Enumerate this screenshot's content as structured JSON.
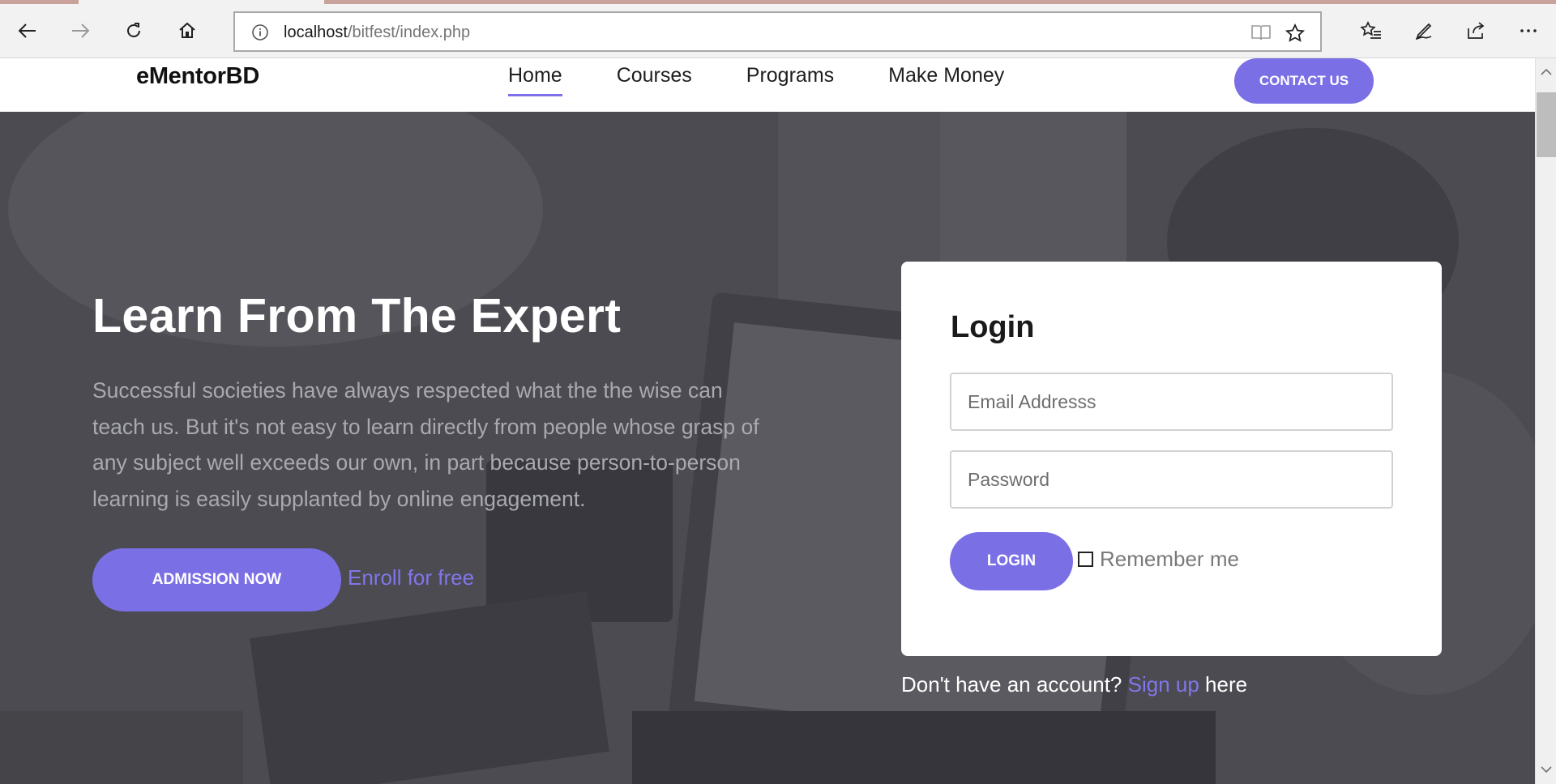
{
  "browser": {
    "url_host": "localhost",
    "url_path": "/bitfest/index.php",
    "icons": [
      "back-icon",
      "forward-icon",
      "refresh-icon",
      "home-icon",
      "info-icon",
      "reading-view-icon",
      "favorite-star-icon",
      "favorites-list-icon",
      "pen-icon",
      "share-icon",
      "more-icon"
    ]
  },
  "header": {
    "logo": "eMentorBD",
    "nav": [
      {
        "label": "Home",
        "active": true
      },
      {
        "label": "Courses",
        "active": false
      },
      {
        "label": "Programs",
        "active": false
      },
      {
        "label": "Make Money",
        "active": false
      }
    ],
    "contact_label": "CONTACT US"
  },
  "hero": {
    "title": "Learn From The Expert",
    "text": "Successful societies have always respected what the the wise can teach us. But it's not easy to learn directly from people whose grasp of any subject well exceeds our own, in part because person-to-person learning is easily supplanted by online engagement.",
    "admission_label": "ADMISSION NOW",
    "enroll_label": "Enroll for free"
  },
  "login": {
    "title": "Login",
    "email_placeholder": "Email Addresss",
    "password_placeholder": "Password",
    "button_label": "LOGIN",
    "remember_label": "Remember me",
    "signup_prefix": "Don't have an account? ",
    "signup_link": "Sign up",
    "signup_suffix": " here"
  },
  "colors": {
    "accent": "#7b6fe6",
    "hero_bg": "#4c4c52",
    "link": "#8176ea"
  }
}
